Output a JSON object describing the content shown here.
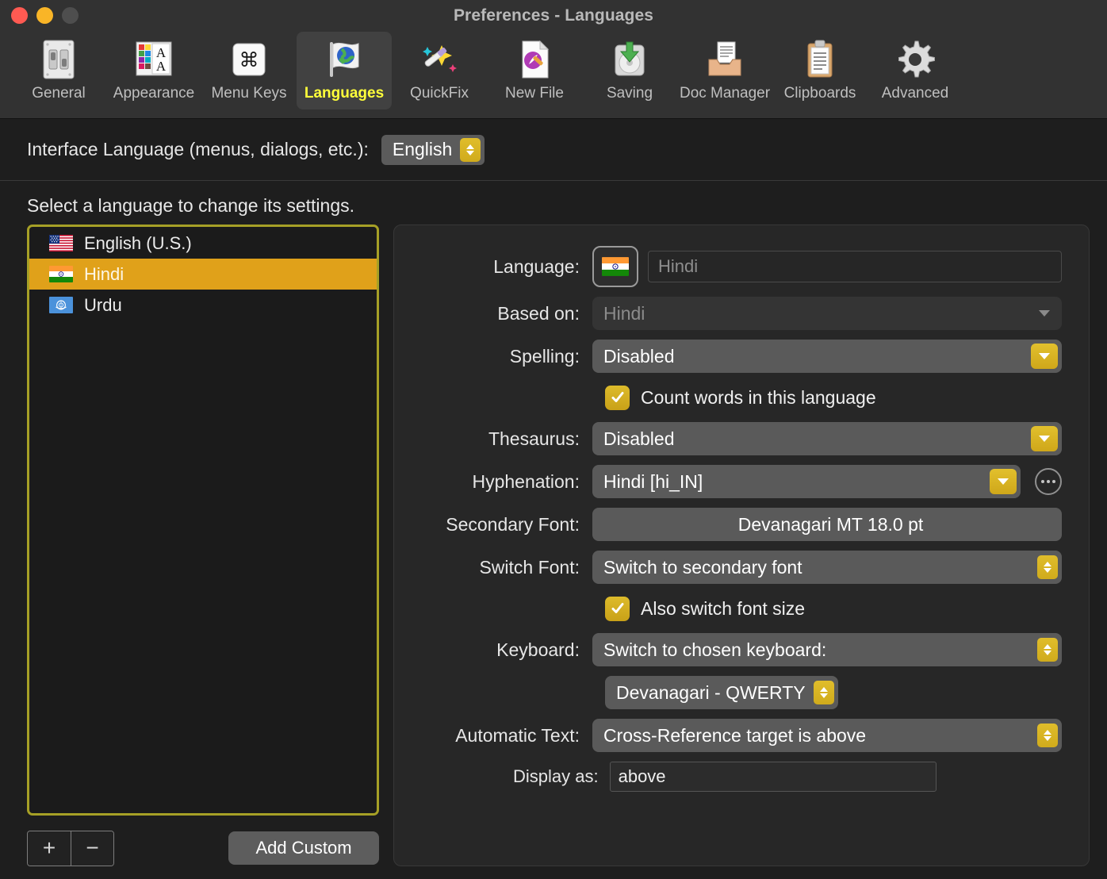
{
  "window": {
    "title": "Preferences - Languages",
    "traffic_lights": [
      "close-button",
      "minimize-button",
      "zoom-button"
    ]
  },
  "toolbar": {
    "items": [
      {
        "label": "General",
        "icon": "toggle-switch-icon",
        "selected": false
      },
      {
        "label": "Appearance",
        "icon": "color-palette-a-icon",
        "selected": false
      },
      {
        "label": "Menu Keys",
        "icon": "command-key-icon",
        "selected": false
      },
      {
        "label": "Languages",
        "icon": "globe-flag-icon",
        "selected": true
      },
      {
        "label": "QuickFix",
        "icon": "magic-wand-icon",
        "selected": false
      },
      {
        "label": "New File",
        "icon": "new-document-icon",
        "selected": false
      },
      {
        "label": "Saving",
        "icon": "save-disk-icon",
        "selected": false
      },
      {
        "label": "Doc Manager",
        "icon": "document-tray-icon",
        "selected": false
      },
      {
        "label": "Clipboards",
        "icon": "clipboard-icon",
        "selected": false
      },
      {
        "label": "Advanced",
        "icon": "gear-icon",
        "selected": false
      }
    ]
  },
  "interface_language": {
    "label": "Interface Language (menus, dialogs, etc.):",
    "value": "English"
  },
  "hint": "Select a language to change its settings.",
  "language_list": {
    "items": [
      {
        "name": "English (U.S.)",
        "flag": "us-flag",
        "selected": false
      },
      {
        "name": "Hindi",
        "flag": "india-flag",
        "selected": true
      },
      {
        "name": "Urdu",
        "flag": "un-flag",
        "selected": false
      }
    ]
  },
  "left_buttons": {
    "add": "+",
    "remove": "−",
    "add_custom": "Add Custom"
  },
  "settings": {
    "language": {
      "label": "Language:",
      "value": "Hindi",
      "flag": "india-flag"
    },
    "based_on": {
      "label": "Based on:",
      "value": "Hindi"
    },
    "spelling": {
      "label": "Spelling:",
      "value": "Disabled"
    },
    "count_words": {
      "label": "Count words in this language",
      "checked": true
    },
    "thesaurus": {
      "label": "Thesaurus:",
      "value": "Disabled"
    },
    "hyphenation": {
      "label": "Hyphenation:",
      "value": "Hindi [hi_IN]",
      "more": "more-options-button"
    },
    "secondary_font": {
      "label": "Secondary Font:",
      "value": "Devanagari MT 18.0 pt"
    },
    "switch_font": {
      "label": "Switch Font:",
      "value": "Switch to secondary font"
    },
    "also_switch_font_size": {
      "label": "Also switch font size",
      "checked": true
    },
    "keyboard": {
      "label": "Keyboard:",
      "value": "Switch to chosen keyboard:",
      "layout": "Devanagari - QWERTY"
    },
    "automatic_text": {
      "label": "Automatic Text:",
      "value": "Cross-Reference target is above"
    },
    "display_as": {
      "label": "Display as:",
      "value": "above"
    }
  },
  "colors": {
    "accent_yellow": "#d8b21f",
    "selection_orange": "#e0a11a",
    "focus_border": "#a6a026",
    "window_bg": "#1e1e1e",
    "toolbar_bg": "#323232",
    "selected_tab_text": "#ffff3a"
  }
}
